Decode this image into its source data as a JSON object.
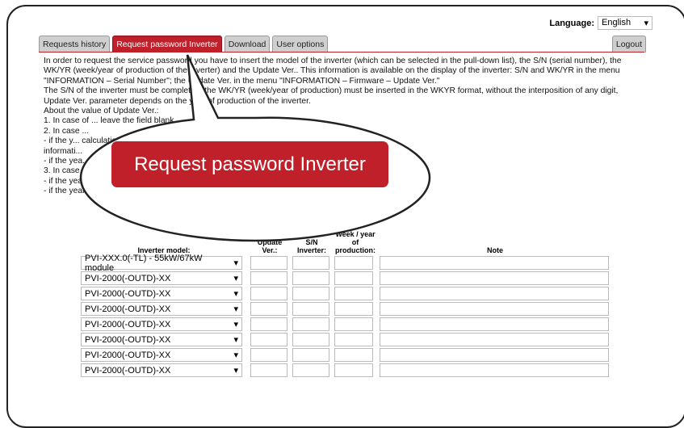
{
  "language": {
    "label": "Language:",
    "value": "English"
  },
  "tabs": [
    {
      "label": "Requests history"
    },
    {
      "label": "Request password Inverter"
    },
    {
      "label": "Download"
    },
    {
      "label": "User options"
    }
  ],
  "logout_label": "Logout",
  "intro": {
    "p1": "In order to request the service password you have to insert the model of the inverter (which can be selected in the pull-down list), the S/N (serial number), the WK/YR (week/year of production of the inverter) and the Update Ver.. This information is available on the display of the inverter: S/N and WK/YR in the menu \"INFORMATION – Serial Number\"; the Update Ver. in the menu \"INFORMATION – Firmware – Update Ver.\"",
    "p2": "The S/N of the inverter must be completed; the WK/YR (week/year of production) must be inserted in the WKYR format, without the interposition of any digit, Update Ver. parameter depends on the year of production of the inverter.",
    "p3": "About the value of Update Ver.:",
    "p4": "1. In case of ... leave the field blank.",
    "p5": "2. In case ...",
    "p6": "- if the y... calculation and the field must be filled with the",
    "p7": "informati...",
    "p8": "- if the yea... can be left blank.",
    "p9": "3. In case on ...",
    "p10": "- if the year of product ... sert as week/year of production 0113.",
    "p11": "- if the year of production is 13 ... ng care to insert week/year as shown on the inverter display."
  },
  "table": {
    "headers": [
      "Inverter model:",
      "Update Ver.:",
      "S/N Inverter:",
      "Week / year of production:",
      "Note"
    ],
    "rows": [
      "PVI-XXX.0(-TL) - 55kW/67kW module",
      "PVI-2000(-OUTD)-XX",
      "PVI-2000(-OUTD)-XX",
      "PVI-2000(-OUTD)-XX",
      "PVI-2000(-OUTD)-XX",
      "PVI-2000(-OUTD)-XX",
      "PVI-2000(-OUTD)-XX",
      "PVI-2000(-OUTD)-XX"
    ]
  },
  "callout_label": "Request password Inverter",
  "colors": {
    "accent": "#c0202a",
    "tab_bg": "#cfcfcf"
  }
}
